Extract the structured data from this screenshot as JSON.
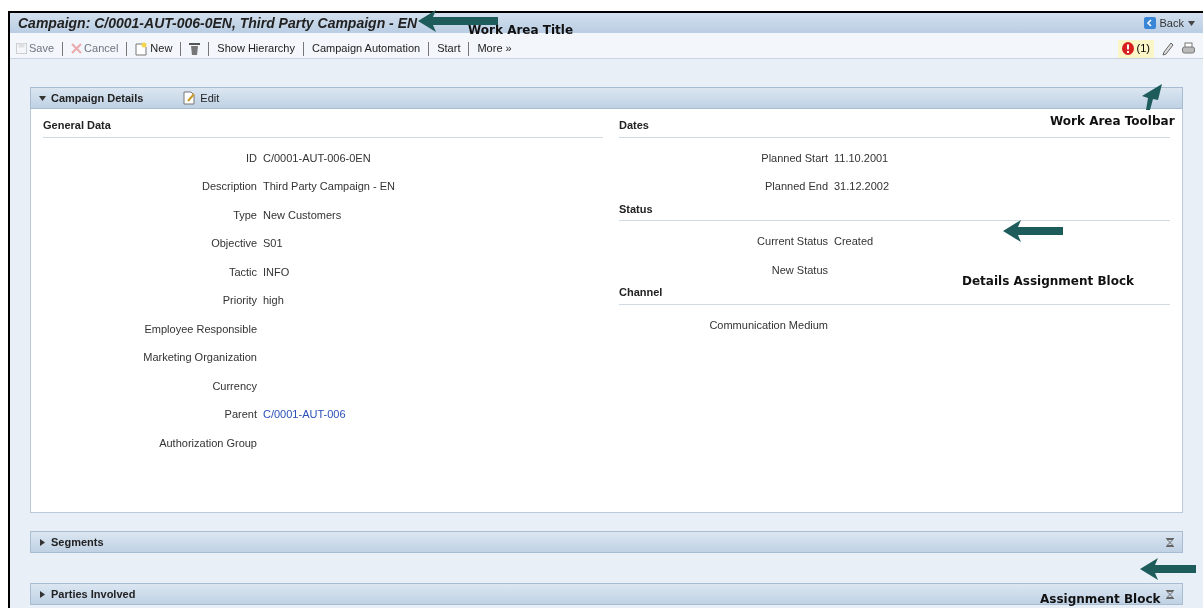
{
  "window": {
    "title": "Campaign: C/0001-AUT-006-0EN, Third Party Campaign - EN",
    "back": "Back"
  },
  "toolbar": {
    "buttons": [
      {
        "kind": "save",
        "label": "Save",
        "disabled": true
      },
      {
        "kind": "cancel",
        "label": "Cancel",
        "disabled": true
      },
      {
        "kind": "new",
        "label": "New",
        "disabled": false
      },
      {
        "kind": "delete",
        "disabled": false
      },
      {
        "kind": "text",
        "label": "Show Hierarchy",
        "disabled": false
      },
      {
        "kind": "text",
        "label": "Campaign Automation",
        "disabled": false
      },
      {
        "kind": "text",
        "label": "Start",
        "disabled": false
      },
      {
        "kind": "text",
        "label": "More »",
        "disabled": false
      }
    ],
    "messages": "(1)"
  },
  "details": {
    "title": "Campaign Details",
    "expanded": true,
    "edit": "Edit",
    "general": {
      "title": "General Data",
      "fields": [
        {
          "label": "ID",
          "value": "C/0001-AUT-006-0EN",
          "kind": "text"
        },
        {
          "label": "Description",
          "value": "Third Party Campaign - EN",
          "kind": "text"
        },
        {
          "label": "Type",
          "value": "New Customers",
          "kind": "text"
        },
        {
          "label": "Objective",
          "value": "S01",
          "kind": "text"
        },
        {
          "label": "Tactic",
          "value": "INFO",
          "kind": "text"
        },
        {
          "label": "Priority",
          "value": "high",
          "kind": "text"
        },
        {
          "label": "Employee Responsible"
        },
        {
          "label": "Marketing Organization"
        },
        {
          "label": "Currency"
        },
        {
          "label": "Parent",
          "value": "C/0001-AUT-006",
          "kind": "link"
        },
        {
          "label": "Authorization Group"
        }
      ]
    },
    "sections": [
      {
        "title": "Dates",
        "fields": [
          {
            "label": "Planned Start",
            "value": "11.10.2001"
          },
          {
            "label": "Planned End",
            "value": "31.12.2002"
          }
        ]
      },
      {
        "title": "Status",
        "fields": [
          {
            "label": "Current Status",
            "value": "Created"
          },
          {
            "label": "New Status"
          }
        ]
      },
      {
        "title": "Channel",
        "fields": [
          {
            "label": "Communication Medium"
          }
        ]
      }
    ]
  },
  "blocks": [
    {
      "title": "Segments",
      "expanded": false
    },
    {
      "title": "Parties Involved",
      "expanded": false
    }
  ],
  "annotations": [
    {
      "text": "Work Area Title",
      "kind": "title"
    },
    {
      "text": "Work Area Toolbar",
      "kind": "toolbar"
    },
    {
      "text": "Details Assignment Block",
      "kind": "details"
    },
    {
      "text": "Assignment Block",
      "kind": "block"
    }
  ]
}
